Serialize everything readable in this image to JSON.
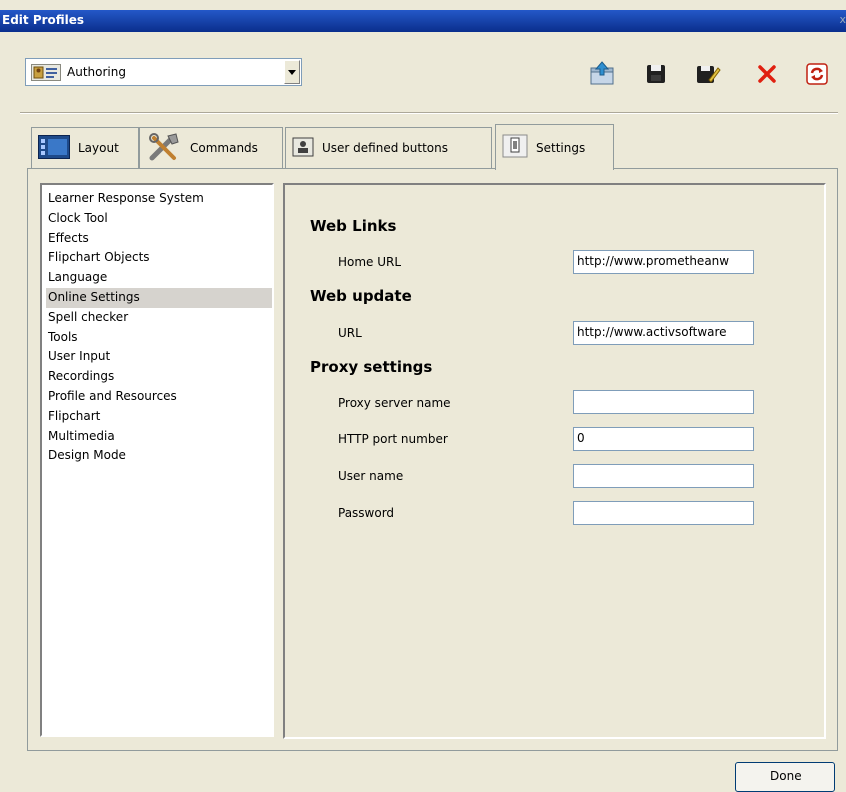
{
  "window": {
    "title": "Edit Profiles",
    "close": "x"
  },
  "profile": {
    "selected": "Authoring"
  },
  "toolbar": {
    "icons": [
      "export-profile-icon",
      "save-icon",
      "save-as-icon",
      "delete-icon",
      "reset-icon"
    ],
    "delete_color": "#e02010"
  },
  "tabs": [
    {
      "label": "Layout",
      "icon": "layout-icon"
    },
    {
      "label": "Commands",
      "icon": "tools-icon"
    },
    {
      "label": "User defined buttons",
      "icon": "user-button-icon"
    },
    {
      "label": "Settings",
      "icon": "settings-icon",
      "active": true
    }
  ],
  "categories": [
    "Learner Response System",
    "Clock Tool",
    "Effects",
    "Flipchart Objects",
    "Language",
    "Online Settings",
    "Spell checker",
    "Tools",
    "User Input",
    "Recordings",
    "Profile and Resources",
    "Flipchart",
    "Multimedia",
    "Design Mode"
  ],
  "selected_category": "Online Settings",
  "settings": {
    "web_links": {
      "heading": "Web Links",
      "home_url_label": "Home URL",
      "home_url_value": "http://www.prometheanw"
    },
    "web_update": {
      "heading": "Web update",
      "url_label": "URL",
      "url_value": "http://www.activsoftware"
    },
    "proxy": {
      "heading": "Proxy settings",
      "server_label": "Proxy server name",
      "server_value": "",
      "port_label": "HTTP port number",
      "port_value": "0",
      "user_label": "User name",
      "user_value": "",
      "password_label": "Password",
      "password_value": ""
    }
  },
  "footer": {
    "done_label": "Done"
  }
}
